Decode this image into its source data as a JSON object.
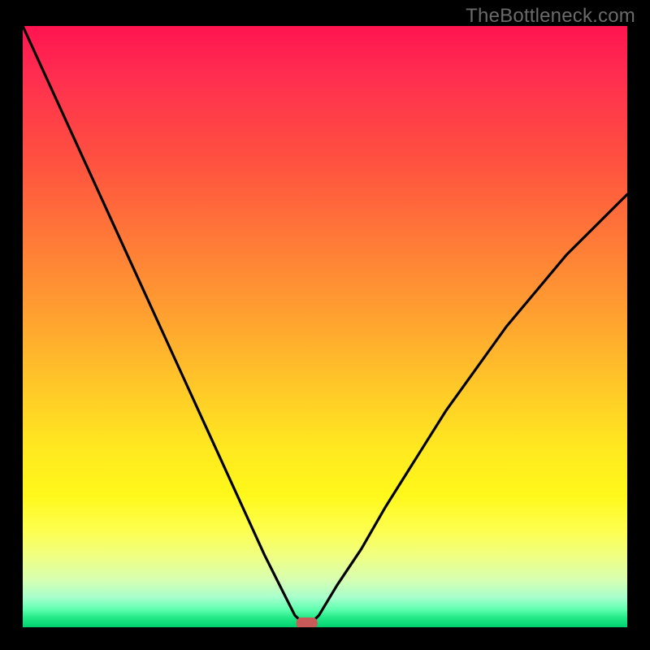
{
  "watermark": "TheBottleneck.com",
  "chart_data": {
    "type": "line",
    "title": "",
    "xlabel": "",
    "ylabel": "",
    "xlim": [
      0,
      100
    ],
    "ylim": [
      0,
      100
    ],
    "grid": false,
    "legend": false,
    "description": "Bottleneck curve showing mismatch percentage vs component balance. Minimum (optimal point) near x≈47 where bottleneck approaches 0. Background gradient encodes severity: red=high bottleneck, green=low.",
    "series": [
      {
        "name": "bottleneck-curve",
        "x": [
          0,
          5,
          10,
          15,
          20,
          25,
          30,
          35,
          40,
          43,
          45,
          47,
          49,
          52,
          56,
          60,
          65,
          70,
          75,
          80,
          85,
          90,
          95,
          100
        ],
        "values": [
          100,
          89,
          78,
          67,
          56,
          45,
          34,
          23,
          12,
          6,
          2,
          0,
          2,
          7,
          13,
          20,
          28,
          36,
          43,
          50,
          56,
          62,
          67,
          72
        ]
      }
    ],
    "marker": {
      "x": 47,
      "y": 0,
      "shape": "rounded-rect",
      "color": "#c85a5a"
    },
    "gradient_stops": [
      {
        "pct": 0,
        "color": "#ff1450"
      },
      {
        "pct": 50,
        "color": "#ffb028"
      },
      {
        "pct": 80,
        "color": "#fff820"
      },
      {
        "pct": 100,
        "color": "#00d070"
      }
    ]
  }
}
